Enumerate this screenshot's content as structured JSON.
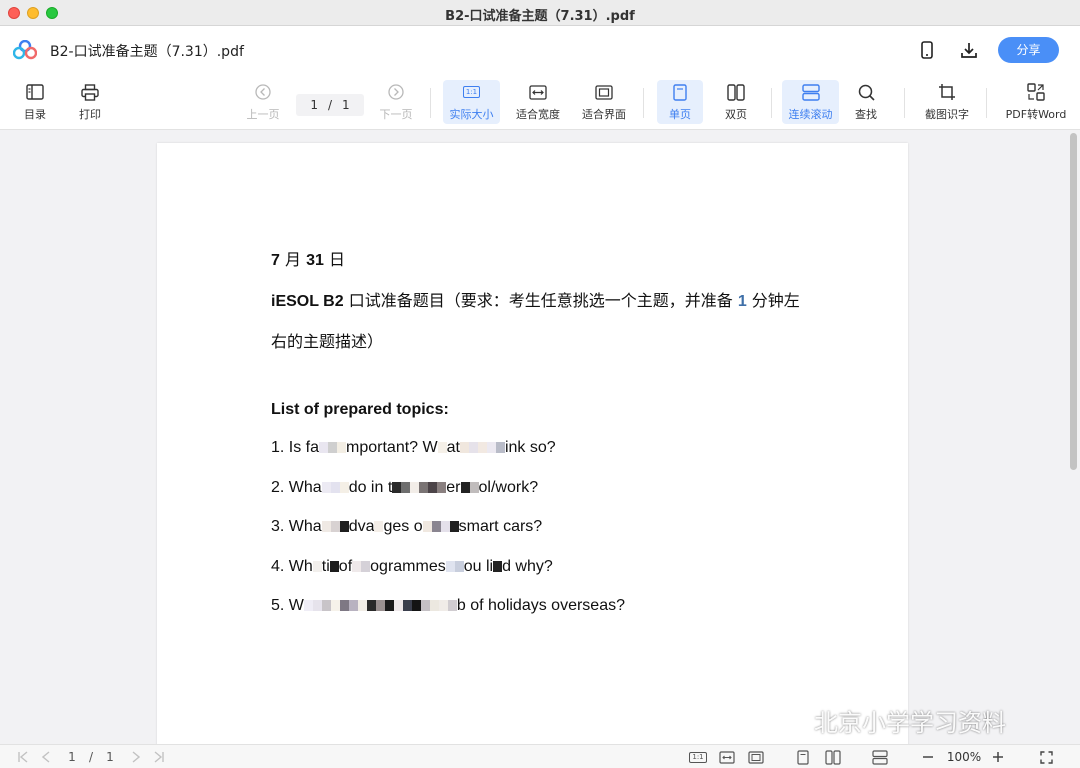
{
  "window": {
    "title": "B2-口试准备主题（7.31）.pdf"
  },
  "appbar": {
    "doc_title": "B2-口试准备主题（7.31）.pdf",
    "share_label": "分享"
  },
  "toolbar": {
    "toc_label": "目录",
    "print_label": "打印",
    "prev_label": "上一页",
    "next_label": "下一页",
    "current_page": "1",
    "page_separator": "/",
    "total_pages": "1",
    "actual_size_label": "实际大小",
    "fit_width_label": "适合宽度",
    "fit_window_label": "适合界面",
    "single_page_label": "单页",
    "double_page_label": "双页",
    "continuous_label": "连续滚动",
    "find_label": "查找",
    "ocr_label": "截图识字",
    "pdf_to_word_label": "PDF转Word",
    "actual_size_glyph": "1:1"
  },
  "document": {
    "date_month_num": "7",
    "date_month_char": " 月 ",
    "date_day_num": "31",
    "date_day_char": " 日",
    "intro_code": "iESOL B2",
    "intro_text": " 口试准备题目（要求：考生任意挑选一个主题，并准备 ",
    "intro_num": "1",
    "intro_text_2": " 分钟左右的主题描述）",
    "topics_heading": "List of prepared topics:",
    "topics": [
      {
        "prefix": "1. Is fa",
        "middle": "mportant? W",
        "middle2": "at",
        "suffix": "ink so?"
      },
      {
        "prefix": "2. Wha",
        "middle": "do in t",
        "middle2": "er",
        "suffix": "ol/work?"
      },
      {
        "prefix": "3. Wha",
        "middle": "dva",
        "middle2": "ges o",
        "suffix": "smart cars?"
      },
      {
        "prefix": "4. Wh",
        "middle": "ti",
        "middle2": "of",
        "suffix": "ogrammes",
        "suffix2": "ou li",
        "suffix3": "d why?"
      },
      {
        "prefix": "5. W",
        "middle": "",
        "middle2": "",
        "suffix": "b of holidays overseas?"
      }
    ]
  },
  "statusbar": {
    "current_page": "1",
    "page_separator": "/",
    "total_pages": "1",
    "zoom": "100%",
    "actual_size_glyph": "1:1"
  },
  "watermark": {
    "text": "北京小学学习资料"
  },
  "colors": {
    "accent": "#3e7ff0",
    "share_button": "#4a8ff7",
    "active_bg": "#e6effd"
  }
}
